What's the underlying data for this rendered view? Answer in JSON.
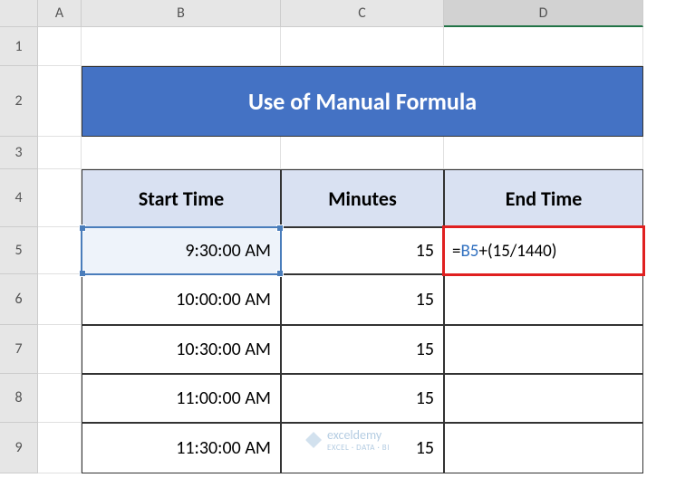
{
  "columns": [
    "A",
    "B",
    "C",
    "D"
  ],
  "rows": [
    "1",
    "2",
    "3",
    "4",
    "5",
    "6",
    "7",
    "8",
    "9"
  ],
  "active_column": "D",
  "active_row": "5",
  "title": "Use of Manual Formula",
  "headers": {
    "start_time": "Start Time",
    "minutes": "Minutes",
    "end_time": "End Time"
  },
  "formula": {
    "prefix": "=",
    "ref": "B5",
    "suffix": "+(15/1440)"
  },
  "data_rows": [
    {
      "start": "9:30:00 AM",
      "minutes": "15",
      "end": ""
    },
    {
      "start": "10:00:00 AM",
      "minutes": "15",
      "end": ""
    },
    {
      "start": "10:30:00 AM",
      "minutes": "15",
      "end": ""
    },
    {
      "start": "11:00:00 AM",
      "minutes": "15",
      "end": ""
    },
    {
      "start": "11:30:00 AM",
      "minutes": "15",
      "end": ""
    }
  ],
  "watermark": {
    "brand": "exceldemy",
    "tagline": "EXCEL · DATA · BI"
  },
  "chart_data": {
    "type": "table",
    "title": "Use of Manual Formula",
    "columns": [
      "Start Time",
      "Minutes",
      "End Time"
    ],
    "rows": [
      [
        "9:30:00 AM",
        15,
        "=B5+(15/1440)"
      ],
      [
        "10:00:00 AM",
        15,
        ""
      ],
      [
        "10:30:00 AM",
        15,
        ""
      ],
      [
        "11:00:00 AM",
        15,
        ""
      ],
      [
        "11:30:00 AM",
        15,
        ""
      ]
    ]
  }
}
